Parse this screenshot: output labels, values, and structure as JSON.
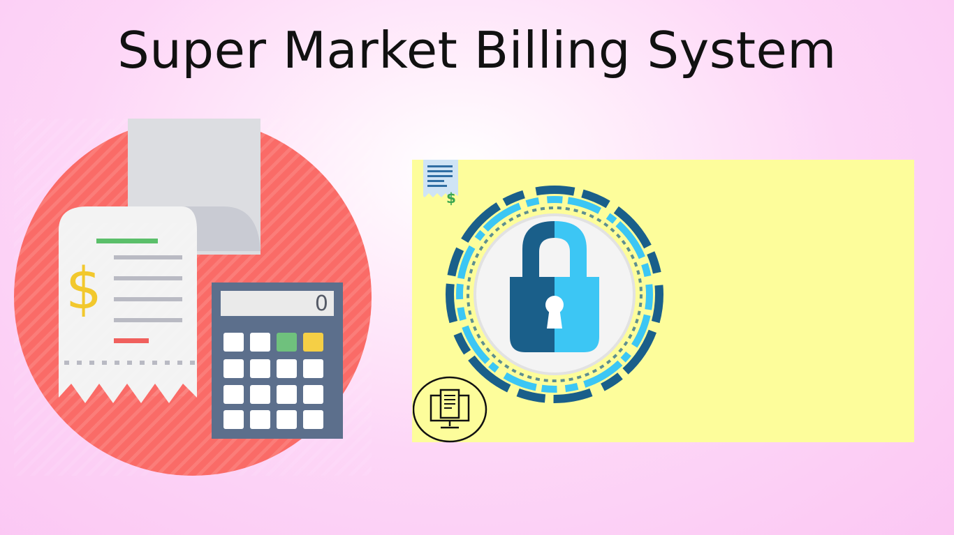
{
  "page": {
    "title": "Super Market Billing System"
  },
  "billing_art": {
    "icon": "receipt-and-calculator-icon",
    "calculator_display": "0",
    "receipt_symbol": "$",
    "colors": {
      "circle": "#fa6b67",
      "receipt": "#f2f2f2",
      "calculator": "#5c6f8c",
      "dollar": "#f2c82d"
    }
  },
  "login_panel": {
    "background": "#fdfd9b",
    "lock_icon": "padlock-icon",
    "receipt_icon": "receipt-dollar-icon",
    "receipt_symbol": "$",
    "monitor_icon": "monitor-document-icon",
    "colors": {
      "lock_dark": "#1a5f8a",
      "lock_light": "#3cc6f4"
    }
  }
}
